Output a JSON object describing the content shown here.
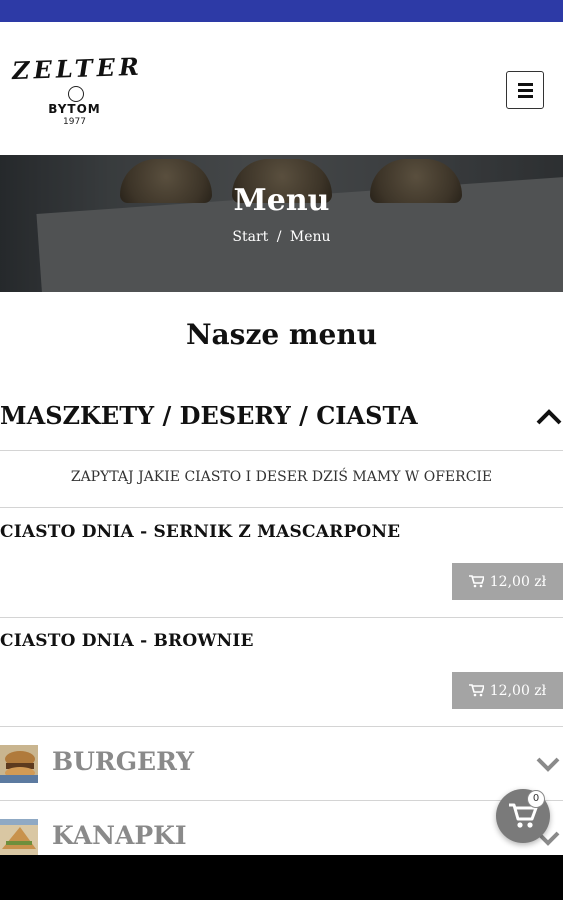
{
  "brand": {
    "name": "ZELTER",
    "city": "BYTOM",
    "year": "1977"
  },
  "hero": {
    "title": "Menu",
    "breadcrumb": [
      "Start",
      "/",
      "Menu"
    ]
  },
  "section_title": "Nasze menu",
  "open_category": {
    "title": "MASZKETY / DESERY / CIASTA",
    "note": "ZAPYTAJ JAKIE CIASTO I DESER DZIŚ MAMY W OFERCIE",
    "items": [
      {
        "name": "CIASTO DNIA - SERNIK Z MASCARPONE",
        "price": "12,00 zł"
      },
      {
        "name": "CIASTO DNIA - BROWNIE",
        "price": "12,00 zł"
      }
    ]
  },
  "categories": [
    {
      "title": "BURGERY"
    },
    {
      "title": "KANAPKI"
    }
  ],
  "cart": {
    "count": "0"
  },
  "colors": {
    "status_bar": "#2d3aa6",
    "price_button": "#a4a4a4",
    "cart_button": "#7a7a7a",
    "collapsed_title": "#8a8a8a"
  },
  "icons": {
    "menu": "hamburger-icon",
    "collapse": "chevron-up-icon",
    "expand": "chevron-down-icon",
    "cart": "cart-icon"
  }
}
